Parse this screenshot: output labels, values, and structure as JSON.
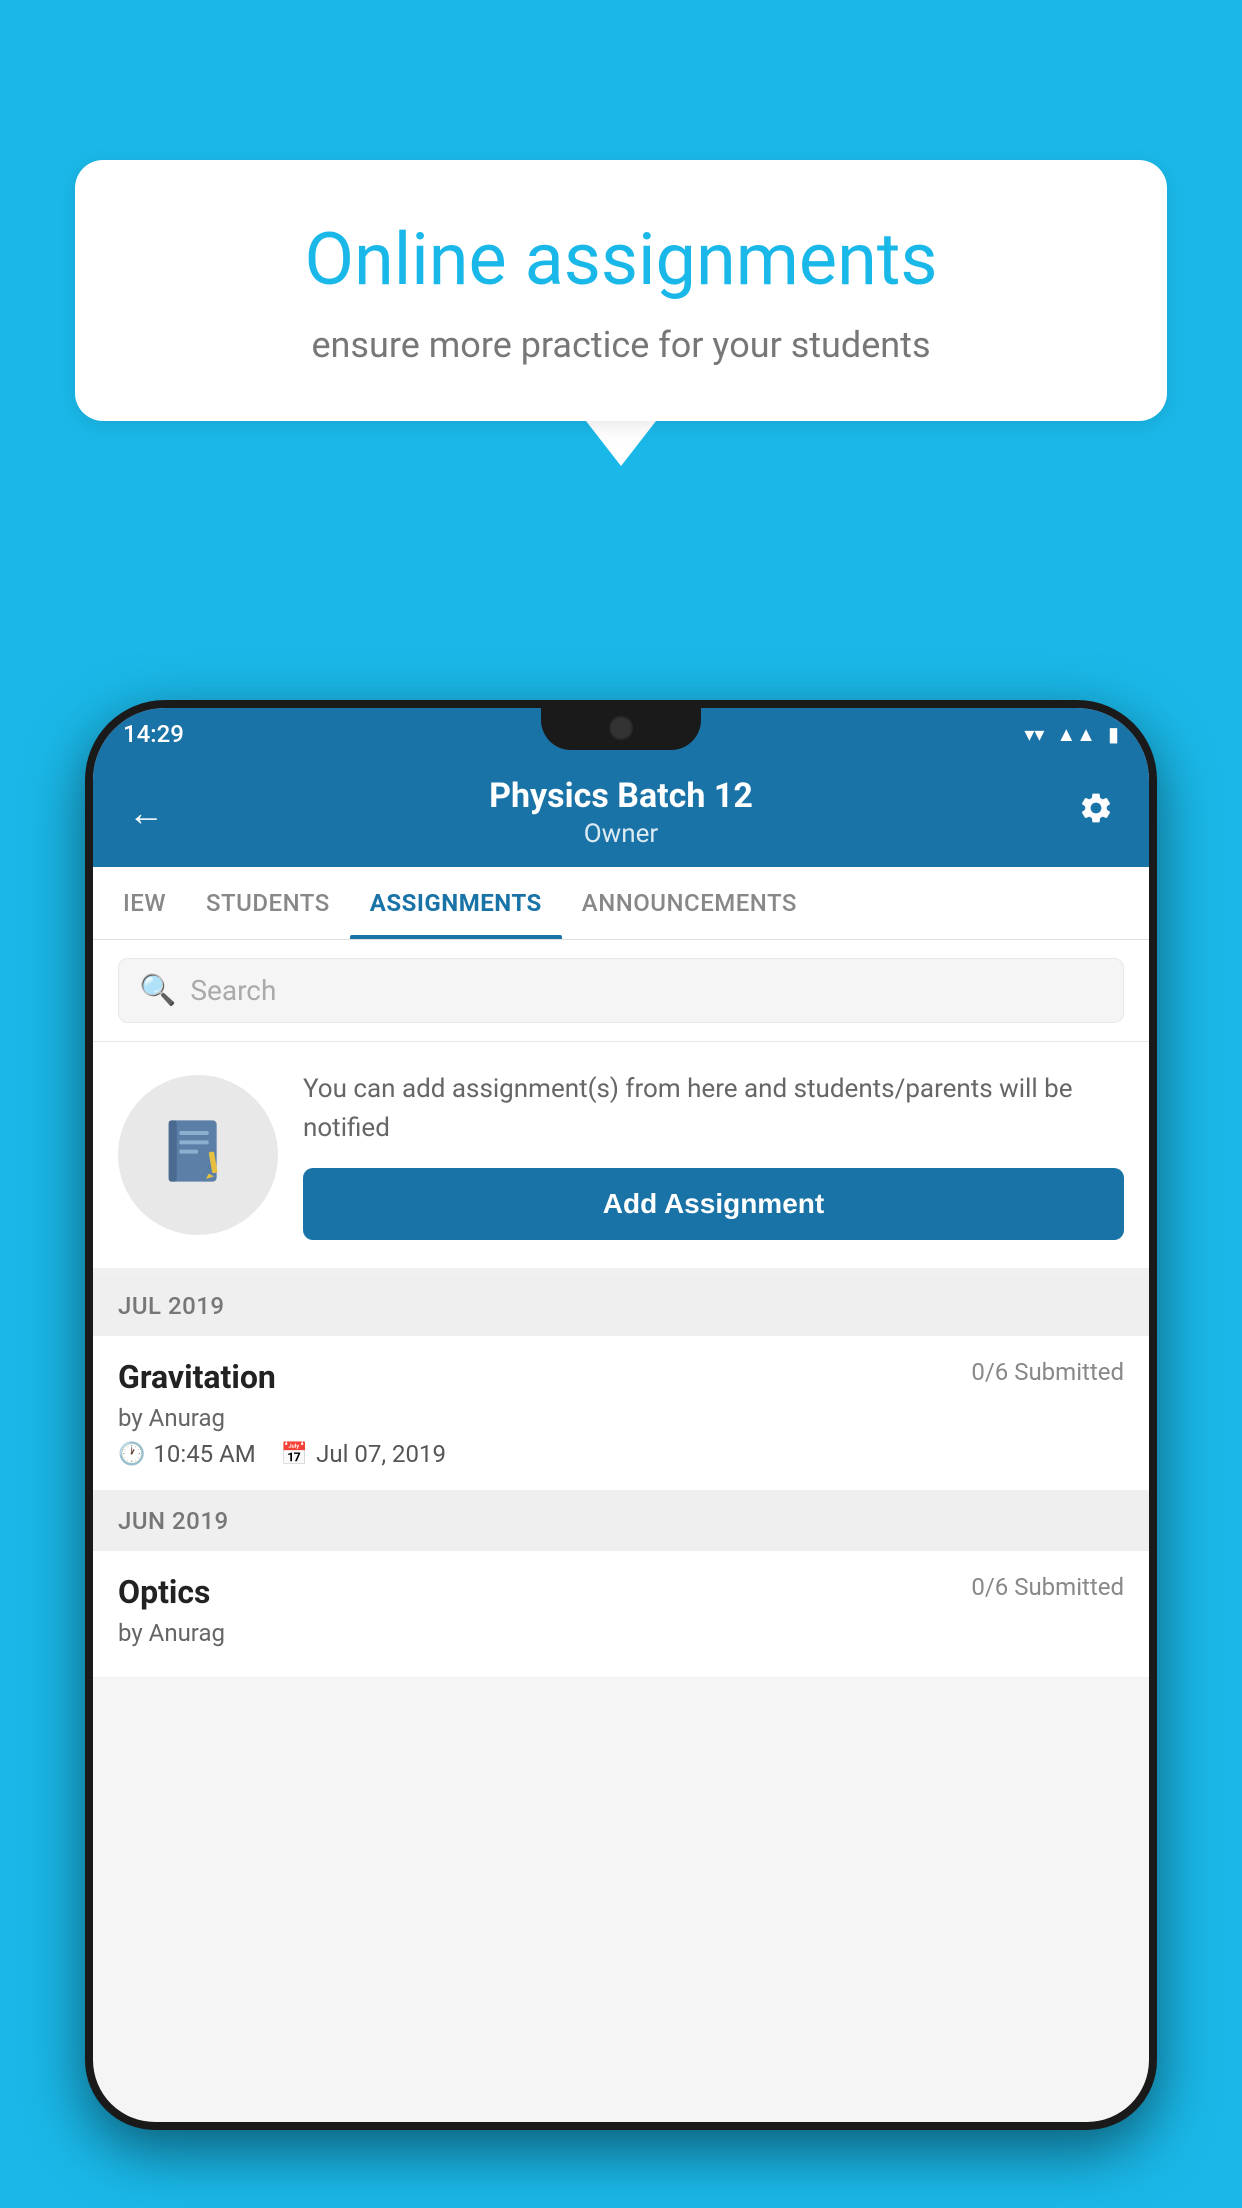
{
  "background_color": "#1ab8e8",
  "speech_bubble": {
    "title": "Online assignments",
    "subtitle": "ensure more practice for your students"
  },
  "phone": {
    "status_bar": {
      "time": "14:29",
      "wifi_icon": "▲",
      "signal_icon": "▲",
      "battery_icon": "▮"
    },
    "header": {
      "back_label": "←",
      "title": "Physics Batch 12",
      "subtitle": "Owner",
      "settings_label": "⚙"
    },
    "tabs": [
      {
        "label": "IEW",
        "active": false
      },
      {
        "label": "STUDENTS",
        "active": false
      },
      {
        "label": "ASSIGNMENTS",
        "active": true
      },
      {
        "label": "ANNOUNCEMENTS",
        "active": false
      }
    ],
    "search": {
      "placeholder": "Search"
    },
    "info_card": {
      "icon": "📓",
      "text": "You can add assignment(s) from here and students/parents will be notified",
      "button_label": "Add Assignment"
    },
    "sections": [
      {
        "month": "JUL 2019",
        "assignments": [
          {
            "name": "Gravitation",
            "submitted": "0/6 Submitted",
            "by": "by Anurag",
            "time": "10:45 AM",
            "date": "Jul 07, 2019"
          }
        ]
      },
      {
        "month": "JUN 2019",
        "assignments": [
          {
            "name": "Optics",
            "submitted": "0/6 Submitted",
            "by": "by Anurag",
            "time": "",
            "date": ""
          }
        ]
      }
    ]
  }
}
